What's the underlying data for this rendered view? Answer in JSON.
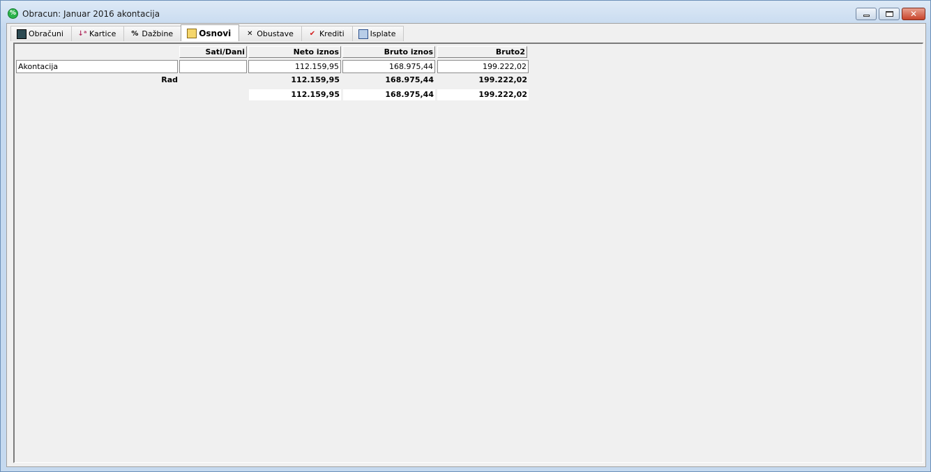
{
  "window": {
    "title": "Obracun: Januar 2016 akontacija",
    "close_glyph": "✕"
  },
  "tabs": [
    {
      "label": "Obračuni",
      "icon": "calculator-icon"
    },
    {
      "label": "Kartice",
      "icon": "sort-az-icon"
    },
    {
      "label": "Dažbine",
      "icon": "percent-icon"
    },
    {
      "label": "Osnovi",
      "icon": "envelope-icon",
      "active": true
    },
    {
      "label": "Obustave",
      "icon": "x-icon"
    },
    {
      "label": "Krediti",
      "icon": "checkmark-icon"
    },
    {
      "label": "Isplate",
      "icon": "stack-icon"
    }
  ],
  "table": {
    "headers": [
      "Sati/Dani",
      "Neto iznos",
      "Bruto iznos",
      "Bruto2"
    ],
    "row": {
      "name": "Akontacija",
      "sati": "",
      "neto": "112.159,95",
      "bruto": "168.975,44",
      "bruto2": "199.222,02"
    },
    "group": {
      "label": "Rad",
      "neto": "112.159,95",
      "bruto": "168.975,44",
      "bruto2": "199.222,02"
    },
    "total": {
      "neto": "112.159,95",
      "bruto": "168.975,44",
      "bruto2": "199.222,02"
    }
  }
}
